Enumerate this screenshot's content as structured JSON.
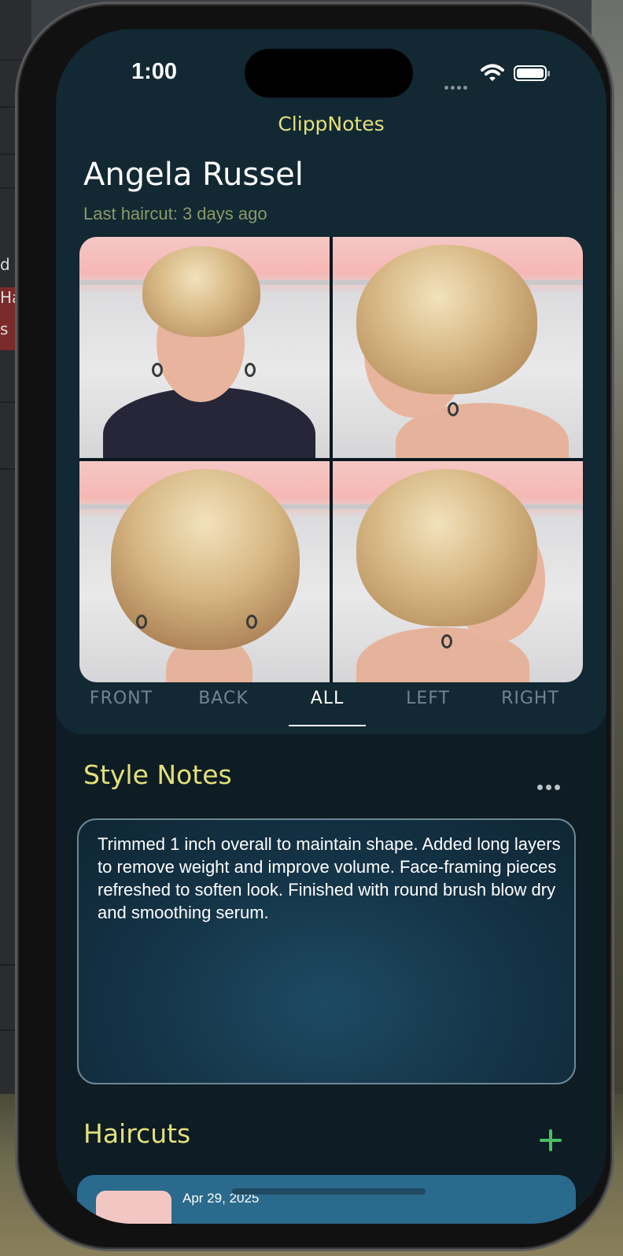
{
  "status_bar": {
    "time": "1:00"
  },
  "app": {
    "title": "ClippNotes"
  },
  "client": {
    "name": "Angela Russel",
    "last_haircut": "Last haircut: 3 days ago"
  },
  "photos": [
    {
      "view": "front"
    },
    {
      "view": "left-profile"
    },
    {
      "view": "back"
    },
    {
      "view": "right-profile"
    }
  ],
  "view_tabs": {
    "items": [
      "FRONT",
      "BACK",
      "ALL",
      "LEFT",
      "RIGHT"
    ],
    "selected": "ALL"
  },
  "style_notes": {
    "title": "Style Notes",
    "text": "Trimmed 1 inch overall to maintain shape. Added long layers to remove weight and improve volume. Face-framing pieces refreshed to soften look. Finished with round brush blow dry and smoothing serum."
  },
  "haircuts": {
    "title": "Haircuts",
    "items": [
      {
        "date": "Apr 29, 2025"
      }
    ]
  },
  "background_window": {
    "fragments": [
      "d",
      "Ha",
      "s"
    ]
  },
  "colors": {
    "accent_yellow": "#e4e07a",
    "subtitle_green": "#8b9a66",
    "add_green": "#48c260",
    "screen_bg": "#0e1c24",
    "card_bg": "#122833"
  },
  "icons": [
    "wifi-icon",
    "battery-icon",
    "signal-icon",
    "more-icon",
    "add-icon"
  ]
}
